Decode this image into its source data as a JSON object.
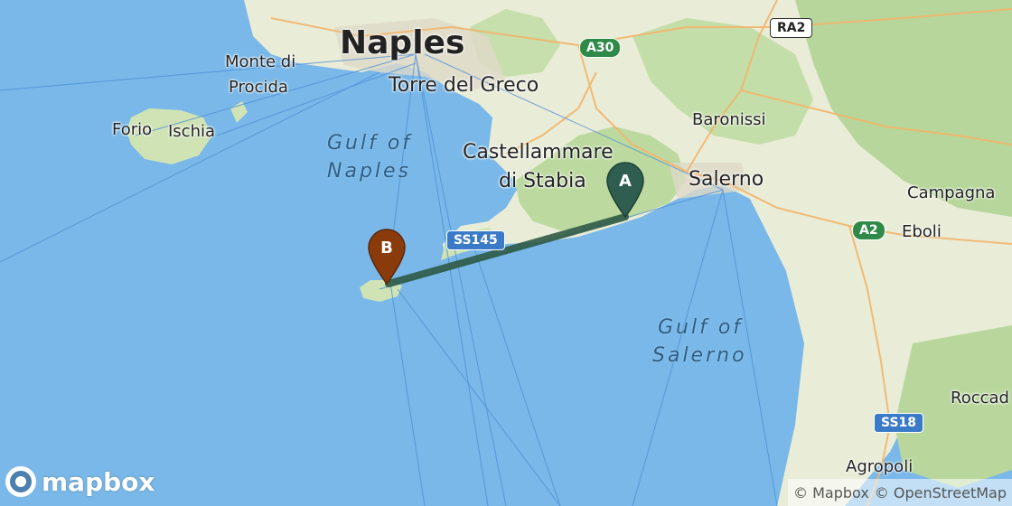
{
  "map": {
    "places": {
      "naples": "Naples",
      "monte_di_procida_1": "Monte di",
      "monte_di_procida_2": "Procida",
      "torre_del_greco": "Torre del Greco",
      "forio": "Forio",
      "ischia": "Ischia",
      "castellammare_1": "Castellammare",
      "castellammare_2": "di Stabia",
      "baronissi": "Baronissi",
      "salerno": "Salerno",
      "campagna": "Campagna",
      "eboli": "Eboli",
      "roccad": "Roccad",
      "agropoli": "Agropoli"
    },
    "water": {
      "gulf_naples_1": "Gulf of",
      "gulf_naples_2": "Naples",
      "gulf_salerno_1": "Gulf of",
      "gulf_salerno_2": "Salerno"
    },
    "roads": {
      "ra2": "RA2",
      "a30": "A30",
      "a2": "A2",
      "ss145": "SS145",
      "ss18": "SS18"
    },
    "markers": {
      "a": {
        "letter": "A",
        "color": "#2f5d50"
      },
      "b": {
        "letter": "B",
        "color": "#8a3b0c"
      }
    },
    "route_color": "#2d5a45",
    "logo_text": "mapbox",
    "attribution": {
      "mapbox": "© Mapbox",
      "osm": "© OpenStreetMap"
    }
  }
}
